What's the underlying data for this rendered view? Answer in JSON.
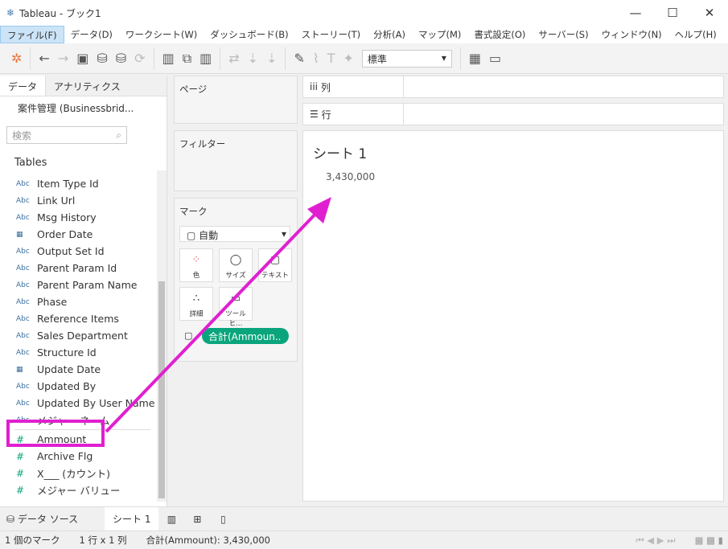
{
  "window": {
    "title": "Tableau - ブック1"
  },
  "menu": [
    "ファイル(F)",
    "データ(D)",
    "ワークシート(W)",
    "ダッシュボード(B)",
    "ストーリー(T)",
    "分析(A)",
    "マップ(M)",
    "書式設定(O)",
    "サーバー(S)",
    "ウィンドウ(N)",
    "ヘルプ(H)"
  ],
  "toolbar": {
    "fit_select": "標準"
  },
  "left": {
    "tabs": [
      "データ",
      "アナリティクス"
    ],
    "datasource": "案件管理 (Businessbrid...",
    "search_placeholder": "検索",
    "tables_label": "Tables",
    "fields": [
      {
        "type": "Abc",
        "name": "Item Type Id"
      },
      {
        "type": "Abc",
        "name": "Link Url"
      },
      {
        "type": "Abc",
        "name": "Msg History"
      },
      {
        "type": "date",
        "name": "Order Date"
      },
      {
        "type": "Abc",
        "name": "Output Set Id"
      },
      {
        "type": "Abc",
        "name": "Parent Param Id"
      },
      {
        "type": "Abc",
        "name": "Parent Param Name"
      },
      {
        "type": "Abc",
        "name": "Phase"
      },
      {
        "type": "Abc",
        "name": "Reference Items"
      },
      {
        "type": "Abc",
        "name": "Sales Department"
      },
      {
        "type": "Abc",
        "name": "Structure Id"
      },
      {
        "type": "date",
        "name": "Update Date"
      },
      {
        "type": "Abc",
        "name": "Updated By"
      },
      {
        "type": "Abc",
        "name": "Updated By User Name"
      },
      {
        "type": "Abc",
        "name": "メジャー ネーム"
      }
    ],
    "measures": [
      {
        "name": "Ammount"
      },
      {
        "name": "Archive Flg"
      },
      {
        "name": "X___ (カウント)"
      },
      {
        "name": "メジャー バリュー"
      }
    ]
  },
  "cards": {
    "pages": "ページ",
    "filters": "フィルター",
    "marks": "マーク",
    "mark_type": "自動",
    "buttons": [
      "色",
      "サイズ",
      "テキスト",
      "詳細",
      "ツールヒ..."
    ],
    "pill": "合計(Ammoun.."
  },
  "shelves": {
    "columns": "列",
    "rows": "行"
  },
  "view": {
    "title": "シート 1",
    "value": "3,430,000"
  },
  "bottom": {
    "datasource_tab": "データ ソース",
    "sheet_tab": "シート 1"
  },
  "status": {
    "marks": "1 個のマーク",
    "dims": "1 行 x 1 列",
    "sum": "合計(Ammount): 3,430,000"
  },
  "colors": {
    "highlight": "#e020d0",
    "pill": "#0aa57c"
  }
}
